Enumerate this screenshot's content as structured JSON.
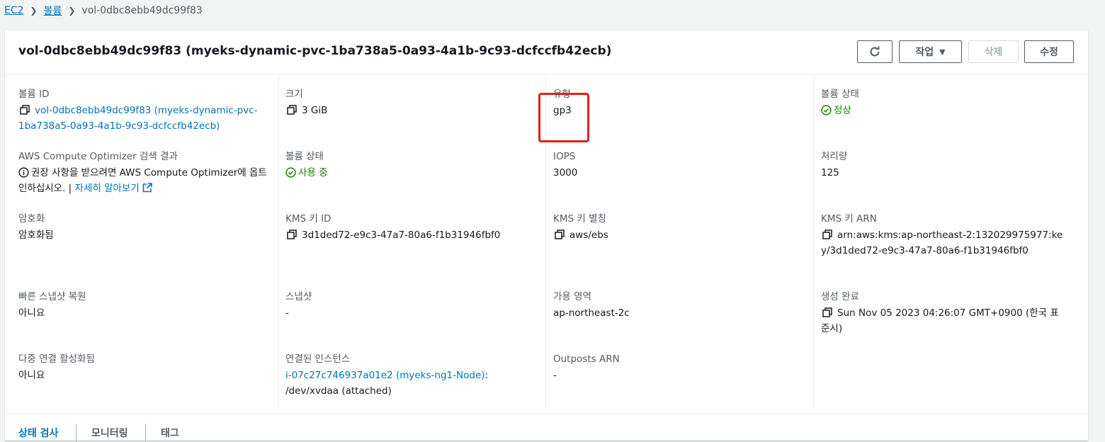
{
  "breadcrumb": {
    "items": [
      "EC2",
      "볼륨"
    ],
    "current": "vol-0dbc8ebb49dc99f83"
  },
  "header": {
    "title": "vol-0dbc8ebb49dc99f83 (myeks-dynamic-pvc-1ba738a5-0a93-4a1b-9c93-dcfccfb42ecb)",
    "refresh_icon": "refresh-icon",
    "action_label": "작업",
    "delete_label": "삭제",
    "edit_label": "수정"
  },
  "details": {
    "volume_id": {
      "label": "볼륨 ID",
      "value": "vol-0dbc8ebb49dc99f83 (myeks-dynamic-pvc-1ba738a5-0a93-4a1b-9c93-dcfccfb42ecb)"
    },
    "size": {
      "label": "크기",
      "value": "3 GiB"
    },
    "type": {
      "label": "유형",
      "value": "gp3"
    },
    "volume_status": {
      "label": "볼륨 상태",
      "value": "정상"
    },
    "optimizer": {
      "label": "AWS Compute Optimizer 검색 결과",
      "text": "권장 사항을 받으려면 AWS Compute Optimizer에 옵트인하십시오. |",
      "link": "자세히 알아보기"
    },
    "volume_state": {
      "label": "볼륨 상태",
      "value": "사용 중"
    },
    "iops": {
      "label": "IOPS",
      "value": "3000"
    },
    "throughput": {
      "label": "처리량",
      "value": "125"
    },
    "encryption": {
      "label": "암호화",
      "value": "암호화됨"
    },
    "kms_key_id": {
      "label": "KMS 키 ID",
      "value": "3d1ded72-e9c3-47a7-80a6-f1b31946fbf0"
    },
    "kms_alias": {
      "label": "KMS 키 별칭",
      "value": "aws/ebs"
    },
    "kms_arn": {
      "label": "KMS 키 ARN",
      "value": "arn:aws:kms:ap-northeast-2:132029975977:key/3d1ded72-e9c3-47a7-80a6-f1b31946fbf0"
    },
    "fast_snapshot": {
      "label": "빠른 스냅샷 복원",
      "value": "아니요"
    },
    "snapshot": {
      "label": "스냅샷",
      "value": "-"
    },
    "az": {
      "label": "가용 영역",
      "value": "ap-northeast-2c"
    },
    "created": {
      "label": "생성 완료",
      "value": "Sun Nov 05 2023 04:26:07 GMT+0900 (한국 표준시)"
    },
    "multi_attach": {
      "label": "다중 연결 활성화됨",
      "value": "아니요"
    },
    "attached_instances": {
      "label": "연결된 인스턴스",
      "link": "i-07c27c746937a01e2 (myeks-ng1-Node)",
      "suffix": ": /dev/xvdaa (attached)"
    },
    "outposts_arn": {
      "label": "Outposts ARN",
      "value": "-"
    }
  },
  "tabs": [
    "상태 검사",
    "모니터링",
    "태그"
  ],
  "colors": {
    "link": "#0073bb",
    "success": "#1d8102",
    "highlight": "#e0201b"
  }
}
